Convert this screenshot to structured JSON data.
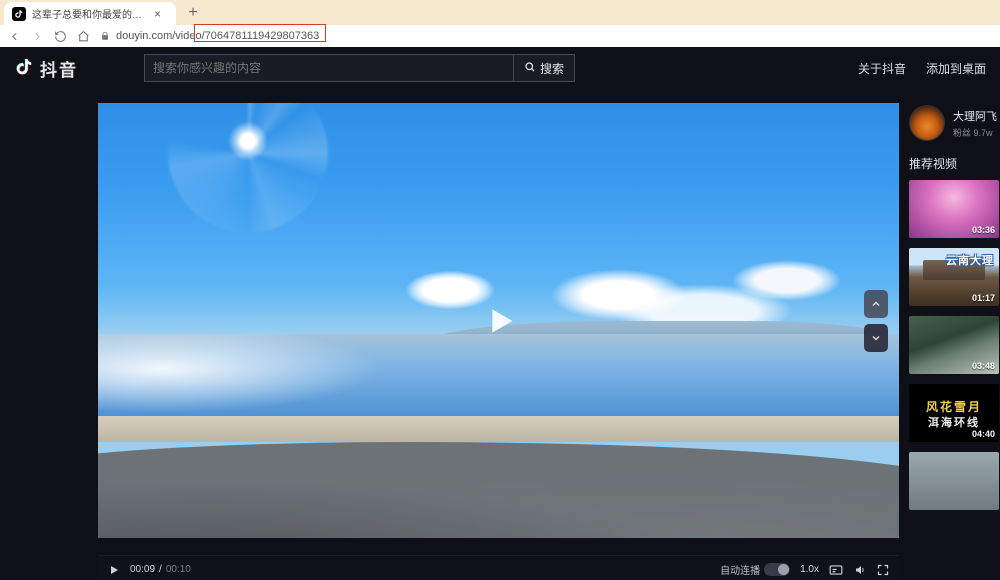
{
  "browser": {
    "tab_title": "这辈子总要和你最爱的人来看一",
    "new_tab_symbol": "+",
    "url": "douyin.com/video/7064781119429807363",
    "highlighted_id": "7064781119429807363"
  },
  "header": {
    "app_name": "抖音",
    "search_placeholder": "搜索你感兴趣的内容",
    "search_button_label": "搜索",
    "links": {
      "about": "关于抖音",
      "desktop": "添加到桌面"
    }
  },
  "player": {
    "current_time": "00:09",
    "duration": "00:10",
    "autoplay_label": "自动连播",
    "autoplay_on": true,
    "speed": "1.0x"
  },
  "author": {
    "name": "大理阿飞",
    "fans_label": "粉丝",
    "fans_count": "9.7w"
  },
  "recommend": {
    "title": "推荐视频",
    "items": [
      {
        "duration": "03:36",
        "overlay": "",
        "caption": ""
      },
      {
        "duration": "01:17",
        "overlay": "云南大理",
        "caption": ""
      },
      {
        "duration": "03:48",
        "overlay": "",
        "caption": ""
      },
      {
        "duration": "04:40",
        "line1": "风花雪月",
        "line2": "洱海环线"
      },
      {
        "duration": "",
        "overlay": "",
        "caption": ""
      }
    ]
  }
}
